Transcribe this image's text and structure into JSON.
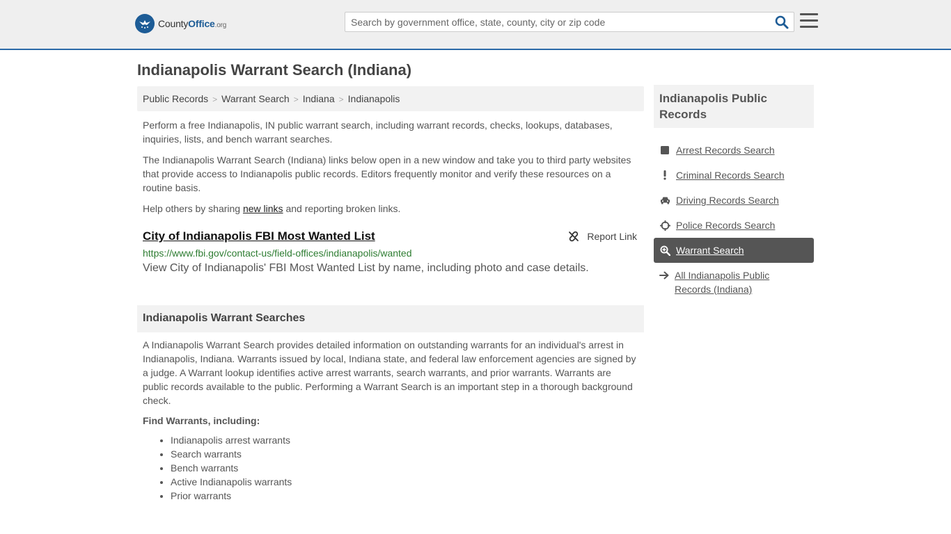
{
  "header": {
    "logo": {
      "part1": "County",
      "part2": "Office",
      "part3": ".org"
    },
    "search_placeholder": "Search by government office, state, county, city or zip code",
    "search_icon": "search-icon",
    "menu_icon": "hamburger-icon"
  },
  "page": {
    "title": "Indianapolis Warrant Search (Indiana)"
  },
  "breadcrumbs": [
    "Public Records",
    "Warrant Search",
    "Indiana",
    "Indianapolis"
  ],
  "intro": {
    "p1": "Perform a free Indianapolis, IN public warrant search, including warrant records, checks, lookups, databases, inquiries, lists, and bench warrant searches.",
    "p2": "The Indianapolis Warrant Search (Indiana) links below open in a new window and take you to third party websites that provide access to Indianapolis public records. Editors frequently monitor and verify these resources on a routine basis.",
    "p3_before": "Help others by sharing ",
    "p3_link": "new links",
    "p3_after": " and reporting broken links."
  },
  "result": {
    "title": "City of Indianapolis FBI Most Wanted List",
    "url": "https://www.fbi.gov/contact-us/field-offices/indianapolis/wanted",
    "description": "View City of Indianapolis' FBI Most Wanted List by name, including photo and case details.",
    "report_label": "Report Link",
    "report_icon": "broken-link-icon"
  },
  "section": {
    "heading": "Indianapolis Warrant Searches",
    "body": "A Indianapolis Warrant Search provides detailed information on outstanding warrants for an individual's arrest in Indianapolis, Indiana. Warrants issued by local, Indiana state, and federal law enforcement agencies are signed by a judge. A Warrant lookup identifies active arrest warrants, search warrants, and prior warrants. Warrants are public records available to the public. Performing a Warrant Search is an important step in a thorough background check.",
    "find_label": "Find Warrants, including:",
    "items": [
      "Indianapolis arrest warrants",
      "Search warrants",
      "Bench warrants",
      "Active Indianapolis warrants",
      "Prior warrants"
    ]
  },
  "sidebar": {
    "heading": "Indianapolis Public Records",
    "items": [
      {
        "label": "Arrest Records Search",
        "icon": "square-icon",
        "active": false
      },
      {
        "label": "Criminal Records Search",
        "icon": "exclamation-icon",
        "active": false
      },
      {
        "label": "Driving Records Search",
        "icon": "car-icon",
        "active": false
      },
      {
        "label": "Police Records Search",
        "icon": "crosshairs-icon",
        "active": false
      },
      {
        "label": "Warrant Search",
        "icon": "search-plus-icon",
        "active": true
      },
      {
        "label": "All Indianapolis Public Records (Indiana)",
        "icon": "arrow-right-icon",
        "active": false
      }
    ]
  },
  "colors": {
    "brand_blue": "#1d5c96",
    "header_border": "#2b6aa8",
    "url_green": "#2e7d32",
    "active_bg": "#555555"
  }
}
